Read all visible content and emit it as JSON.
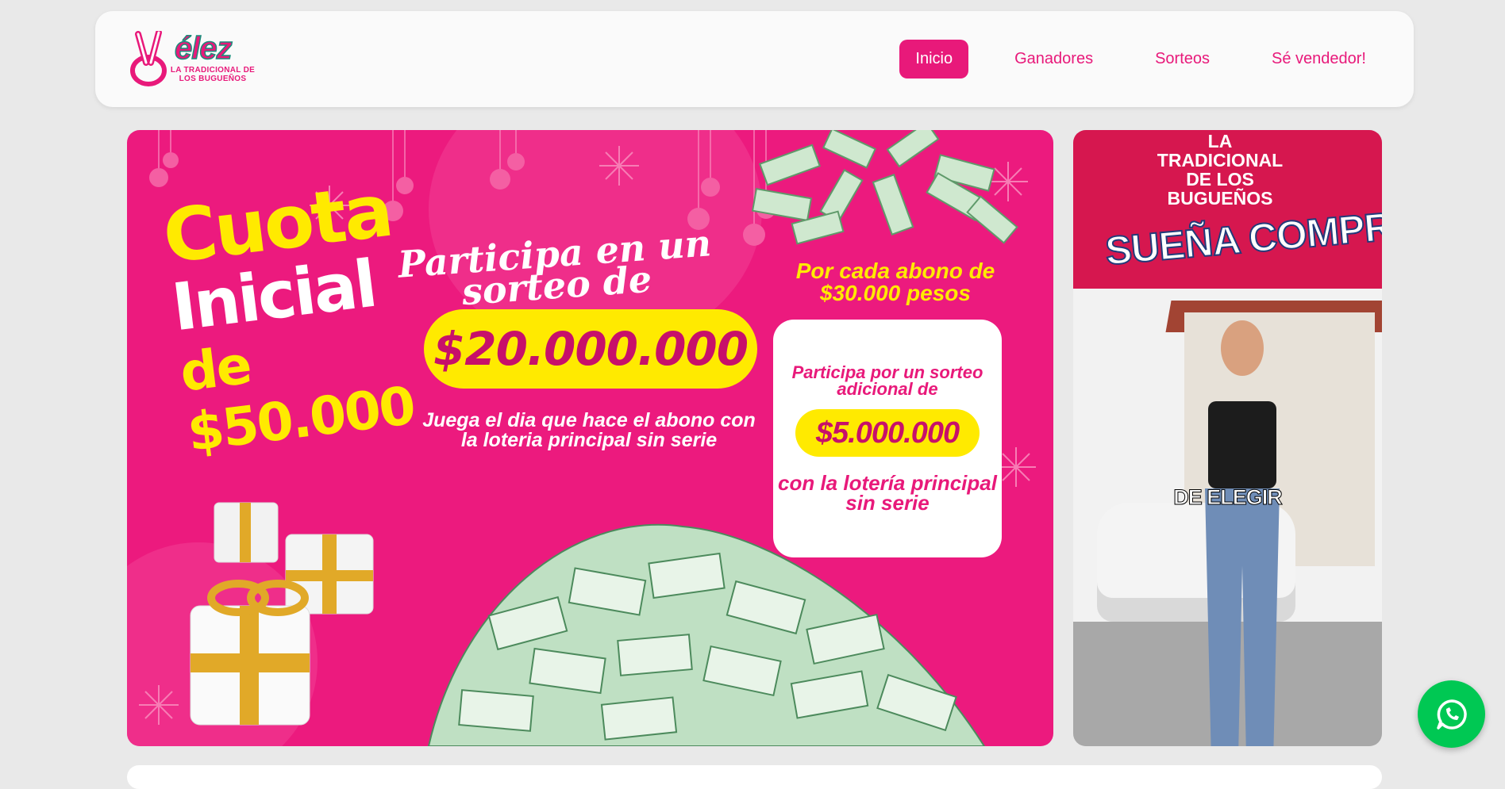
{
  "header": {
    "logo_brand": "élez",
    "logo_tagline": "LA TRADICIONAL DE LOS BUGUEÑOS",
    "nav": [
      {
        "label": "Inicio",
        "active": true
      },
      {
        "label": "Ganadores",
        "active": false
      },
      {
        "label": "Sorteos",
        "active": false
      },
      {
        "label": "Sé vendedor!",
        "active": false
      }
    ]
  },
  "banner": {
    "cuota_line1": "Cuota",
    "cuota_line2": "Inicial",
    "cuota_line3": "de $50.000",
    "participa": "Participa en un sorteo de",
    "main_amount": "$20.000.000",
    "juega": "Juega el dia que hace el abono con la loteria principal sin serie",
    "por_cada": "Por cada abono de $30.000 pesos",
    "card_line1": "Participa por un sorteo adicional de",
    "card_amount": "$5.000.000",
    "card_line2": "con la lotería principal sin serie"
  },
  "photo": {
    "brand": "LA TRADICIONAL DE LOS BUGUEÑOS",
    "headline": "SUEÑA COMPR",
    "caption": "DE ELEGIR"
  },
  "colors": {
    "brand_pink": "#e8197a",
    "yellow": "#ffea00",
    "whatsapp_green": "#00c853"
  },
  "icons": {
    "whatsapp": "whatsapp-icon"
  }
}
